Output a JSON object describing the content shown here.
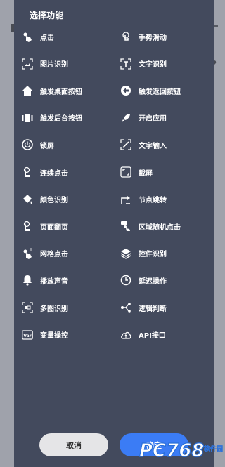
{
  "dialog": {
    "title": "选择功能",
    "items": [
      {
        "label": "点击",
        "icon": "tap-icon"
      },
      {
        "label": "手势滑动",
        "icon": "gesture-swipe-icon"
      },
      {
        "label": "图片识别",
        "icon": "image-recognition-icon"
      },
      {
        "label": "文字识别",
        "icon": "text-recognition-icon"
      },
      {
        "label": "触发桌面按钮",
        "icon": "home-icon"
      },
      {
        "label": "触发返回按钮",
        "icon": "back-icon"
      },
      {
        "label": "触发后台按钮",
        "icon": "recent-apps-icon"
      },
      {
        "label": "开启应用",
        "icon": "rocket-icon"
      },
      {
        "label": "锁屏",
        "icon": "power-icon"
      },
      {
        "label": "文字输入",
        "icon": "text-input-icon"
      },
      {
        "label": "连续点击",
        "icon": "multi-tap-icon"
      },
      {
        "label": "截屏",
        "icon": "screenshot-icon"
      },
      {
        "label": "颜色识别",
        "icon": "paint-bucket-icon"
      },
      {
        "label": "节点跳转",
        "icon": "jump-icon"
      },
      {
        "label": "页面翻页",
        "icon": "page-turn-icon"
      },
      {
        "label": "区域随机点击",
        "icon": "random-tap-icon"
      },
      {
        "label": "网格点击",
        "icon": "grid-tap-icon"
      },
      {
        "label": "控件识别",
        "icon": "layers-icon"
      },
      {
        "label": "播放声音",
        "icon": "bell-icon"
      },
      {
        "label": "延迟操作",
        "icon": "clock-icon"
      },
      {
        "label": "多图识别",
        "icon": "multi-image-icon"
      },
      {
        "label": "逻辑判断",
        "icon": "branch-icon"
      },
      {
        "label": "变量操控",
        "icon": "variable-icon"
      },
      {
        "label": "API接口",
        "icon": "cloud-api-icon"
      }
    ],
    "cancel_label": "取消",
    "confirm_label": "确定"
  },
  "watermark": {
    "brand": "PC768",
    "sub": "软件园"
  },
  "colors": {
    "dialog_bg": "#434a5d",
    "confirm_bg": "#3b7cf5",
    "cancel_bg": "#e5e5e7"
  }
}
